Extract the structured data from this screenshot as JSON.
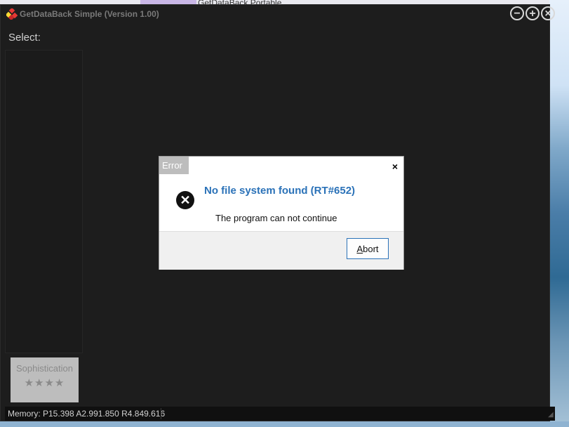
{
  "window": {
    "title": "GetDataBack Simple (Version 1.00)",
    "controls": {
      "minimize": "−",
      "maximize": "+",
      "close": "×"
    }
  },
  "background_window_title": "GetDataBack Portable",
  "main": {
    "select_label": "Select:",
    "sophistication": {
      "label": "Sophistication",
      "stars": "★★★★"
    }
  },
  "statusbar": {
    "memory": "Memory: P15.398 A2.991.850 R4.849.616"
  },
  "dialog": {
    "title": "Error",
    "close": "×",
    "heading": "No file system found (RT#652)",
    "message": "The program can not continue",
    "button": {
      "first_letter": "A",
      "rest": "bort"
    }
  },
  "icons": {
    "app": "getdataback-logo-icon",
    "error": "error-x-icon"
  },
  "colors": {
    "accent_blue": "#2b72b8",
    "window_bg": "#1d1d1d",
    "dialog_title_bg": "#bdbdbd"
  }
}
